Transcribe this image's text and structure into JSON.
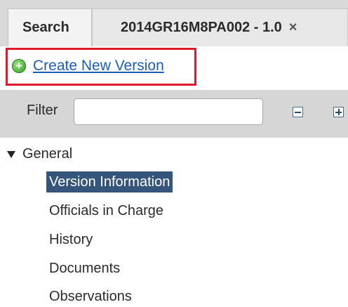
{
  "tabs": {
    "search_label": "Search",
    "version_label": "2014GR16M8PA002 - 1.0",
    "close_glyph": "×"
  },
  "actions": {
    "create_new_version_label": "Create New Version",
    "create_icon": "plus-circle-icon"
  },
  "filter": {
    "label": "Filter",
    "value": "",
    "placeholder": ""
  },
  "tree": {
    "section_label": "General",
    "items": [
      {
        "label": "Version Information",
        "selected": true
      },
      {
        "label": "Officials in Charge",
        "selected": false
      },
      {
        "label": "History",
        "selected": false
      },
      {
        "label": "Documents",
        "selected": false
      },
      {
        "label": "Observations",
        "selected": false
      }
    ]
  },
  "colors": {
    "highlight_border": "#e0182d",
    "link": "#1c5db8",
    "selected_bg": "#36557a",
    "toolbar_bg": "#d6d6d6"
  }
}
